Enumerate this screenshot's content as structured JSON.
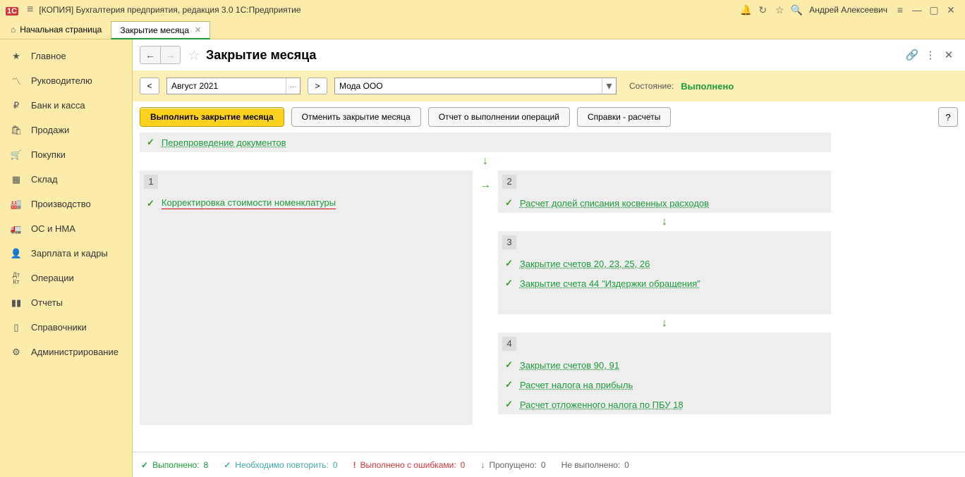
{
  "title_bar": {
    "app_title": "[КОПИЯ] Бухгалтерия предприятия, редакция 3.0 1С:Предприятие",
    "user": "Андрей Алексеевич"
  },
  "tabs": {
    "home": "Начальная страница",
    "active": "Закрытие месяца"
  },
  "sidebar": [
    {
      "icon": "★",
      "label": "Главное"
    },
    {
      "icon": "📈",
      "label": "Руководителю"
    },
    {
      "icon": "₽",
      "label": "Банк и касса"
    },
    {
      "icon": "🛍",
      "label": "Продажи"
    },
    {
      "icon": "🛒",
      "label": "Покупки"
    },
    {
      "icon": "▤",
      "label": "Склад"
    },
    {
      "icon": "🏭",
      "label": "Производство"
    },
    {
      "icon": "🚚",
      "label": "ОС и НМА"
    },
    {
      "icon": "👤",
      "label": "Зарплата и кадры"
    },
    {
      "icon": "ᴬᴷ",
      "label": "Операции"
    },
    {
      "icon": "📊",
      "label": "Отчеты"
    },
    {
      "icon": "▯",
      "label": "Справочники"
    },
    {
      "icon": "⚙",
      "label": "Администрирование"
    }
  ],
  "header": {
    "page_title": "Закрытие месяца"
  },
  "params": {
    "period": "Август 2021",
    "org": "Мода ООО",
    "state_label": "Состояние:",
    "state_value": "Выполнено"
  },
  "actions": {
    "primary": "Выполнить закрытие месяца",
    "cancel": "Отменить закрытие месяца",
    "report": "Отчет о выполнении операций",
    "refs": "Справки - расчеты"
  },
  "steps": {
    "reprocess": "Перепроведение документов",
    "s1_item": "Корректировка стоимости номенклатуры",
    "s2_item": "Расчет долей списания косвенных расходов",
    "s3_a": "Закрытие счетов 20, 23, 25, 26",
    "s3_b": "Закрытие счета 44 \"Издержки обращения\"",
    "s4_a": "Закрытие счетов 90, 91",
    "s4_b": "Расчет налога на прибыль",
    "s4_c": "Расчет отложенного налога по ПБУ 18"
  },
  "footer": {
    "done_label": "Выполнено:",
    "done_val": "8",
    "repeat_label": "Необходимо повторить:",
    "repeat_val": "0",
    "err_label": "Выполнено с ошибками:",
    "err_val": "0",
    "skip_label": "Пропущено:",
    "skip_val": "0",
    "undone_label": "Не выполнено:",
    "undone_val": "0"
  }
}
